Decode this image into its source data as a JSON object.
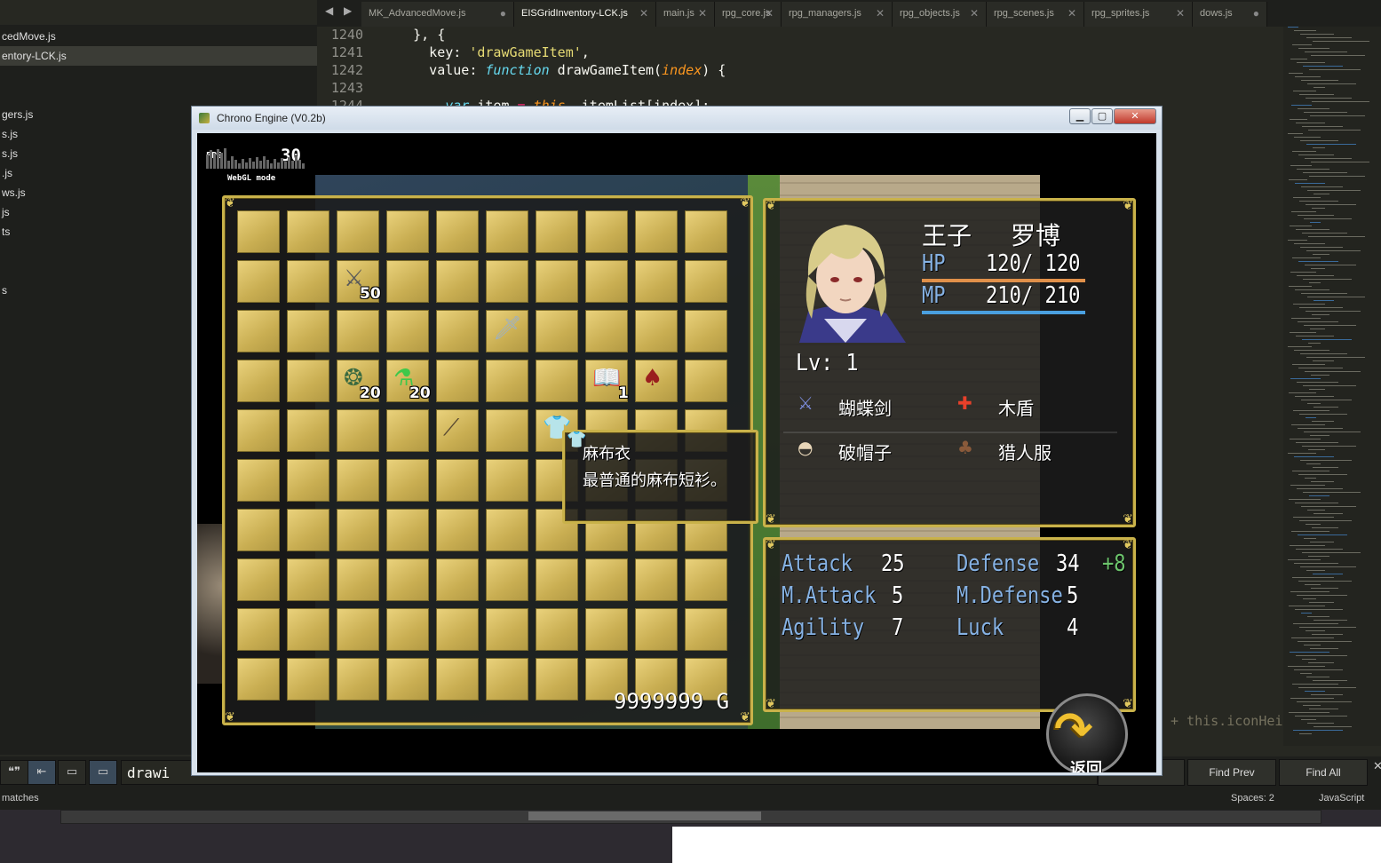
{
  "editor": {
    "tab_arrows": "◀ ▶",
    "tabs": [
      {
        "label": "MK_AdvancedMove.js",
        "active": false
      },
      {
        "label": "EISGridInventory-LCK.js",
        "active": true
      },
      {
        "label": "main.js",
        "active": false
      },
      {
        "label": "rpg_core.js",
        "active": false
      },
      {
        "label": "rpg_managers.js",
        "active": false
      },
      {
        "label": "rpg_objects.js",
        "active": false
      },
      {
        "label": "rpg_scenes.js",
        "active": false
      },
      {
        "label": "rpg_sprites.js",
        "active": false
      },
      {
        "label": "dows.js",
        "active": false
      }
    ],
    "sidebar_files": [
      {
        "label": "cedMove.js",
        "active": false
      },
      {
        "label": "entory-LCK.js",
        "active": true
      },
      {
        "label": "gers.js",
        "active": false
      },
      {
        "label": "s.js",
        "active": false
      },
      {
        "label": "s.js",
        "active": false
      },
      {
        "label": ".js",
        "active": false
      },
      {
        "label": "ws.js",
        "active": false
      },
      {
        "label": "js",
        "active": false
      },
      {
        "label": "ts",
        "active": false
      },
      {
        "label": "s",
        "active": false
      }
    ],
    "code_lines": [
      {
        "num": "1240",
        "text": "    }, {"
      },
      {
        "num": "1241",
        "text": "      key: 'drawGameItem',"
      },
      {
        "num": "1242",
        "text": "      value: function drawGameItem(index) {"
      },
      {
        "num": "1243",
        "text": ""
      },
      {
        "num": "1244",
        "text": "        var item = this._itemList[index];"
      }
    ],
    "hidden_code_fragment": "+ this.iconHei",
    "find": {
      "query": "drawi",
      "find_prev_label": "Find Prev",
      "find_all_label": "Find All"
    },
    "status": {
      "matches": "matches",
      "spaces": "Spaces: 2",
      "language": "JavaScript"
    }
  },
  "game_window": {
    "title": "Chrono Engine (V0.2b)",
    "controls": {
      "minimize": "▁",
      "maximize": "▢",
      "close": "✕"
    },
    "fps": {
      "label": "FPS",
      "value": "30",
      "mode": "WebGL mode"
    },
    "inventory": {
      "rows": 10,
      "cols": 10,
      "items": [
        {
          "name": "crossed-arrows",
          "glyph": "⚔",
          "color": "#5a5a5a",
          "row": 1,
          "col": 2,
          "qty": "50"
        },
        {
          "name": "short-sword",
          "glyph": "🗡",
          "color": "#9ab0c8",
          "row": 2,
          "col": 5,
          "qty": ""
        },
        {
          "name": "herb-pouch",
          "glyph": "❂",
          "color": "#3a6a40",
          "row": 3,
          "col": 2,
          "qty": "20"
        },
        {
          "name": "green-potion",
          "glyph": "⚗",
          "color": "#3ec84a",
          "row": 3,
          "col": 3,
          "qty": "20"
        },
        {
          "name": "spell-book",
          "glyph": "📖",
          "color": "#e8eef6",
          "row": 3,
          "col": 7,
          "qty": "1"
        },
        {
          "name": "red-hood",
          "glyph": "♠",
          "color": "#9a1e1e",
          "row": 3,
          "col": 8,
          "qty": ""
        },
        {
          "name": "spear",
          "glyph": "⟋",
          "color": "#5a4a32",
          "row": 4,
          "col": 4,
          "qty": ""
        },
        {
          "name": "linen-shirt",
          "glyph": "👕",
          "color": "#e8d8c4",
          "row": 4,
          "col": 6,
          "qty": ""
        }
      ],
      "gold": "9999999 G"
    },
    "tooltip": {
      "name": "麻布衣",
      "description": "最普通的麻布短衫。"
    },
    "actor": {
      "class": "王子",
      "name": "罗博",
      "hp_label": "HP",
      "hp_value": "120/ 120",
      "mp_label": "MP",
      "mp_value": "210/ 210",
      "level": "Lv: 1",
      "hp_color": "#e0904a",
      "mp_color": "#4aa0e0",
      "equipment": [
        {
          "slot": "weapon",
          "glyph": "⚔",
          "color": "#7a8ad8",
          "name": "蝴蝶剑"
        },
        {
          "slot": "shield",
          "glyph": "✚",
          "color": "#e8402a",
          "name": "木盾"
        },
        {
          "slot": "head",
          "glyph": "◓",
          "color": "#e8d6b8",
          "name": "破帽子"
        },
        {
          "slot": "body",
          "glyph": "♣",
          "color": "#8a5a3a",
          "name": "猎人服"
        }
      ]
    },
    "params": [
      {
        "label": "Attack",
        "value": "25"
      },
      {
        "label": "Defense",
        "value": "34",
        "bonus": "+8"
      },
      {
        "label": "M.Attack",
        "value": "5"
      },
      {
        "label": "M.Defense",
        "value": "5"
      },
      {
        "label": "Agility",
        "value": "7"
      },
      {
        "label": "Luck",
        "value": "4"
      }
    ],
    "back_button": {
      "label": "返回",
      "glyph": "↶"
    },
    "accent_colors": {
      "frame_gold": "#c9b24a",
      "param_label": "#86b2e4",
      "bonus_green": "#6cc46c"
    }
  }
}
